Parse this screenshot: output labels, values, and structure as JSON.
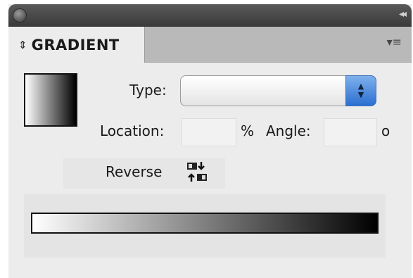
{
  "panel": {
    "collapse_label": "◂◂",
    "tab_arrows": "⇕",
    "tab_title": "GRADIENT",
    "menu_icon": "≡"
  },
  "fields": {
    "type_label": "Type:",
    "type_value": "",
    "location_label": "Location:",
    "location_value": "",
    "percent_unit": "%",
    "angle_label": "Angle:",
    "angle_value": "",
    "angle_unit": "o",
    "reverse_label": "Reverse"
  },
  "gradient": {
    "start_color": "#ffffff",
    "end_color": "#000000"
  },
  "colors": {
    "accent": "#2b6fd1"
  }
}
